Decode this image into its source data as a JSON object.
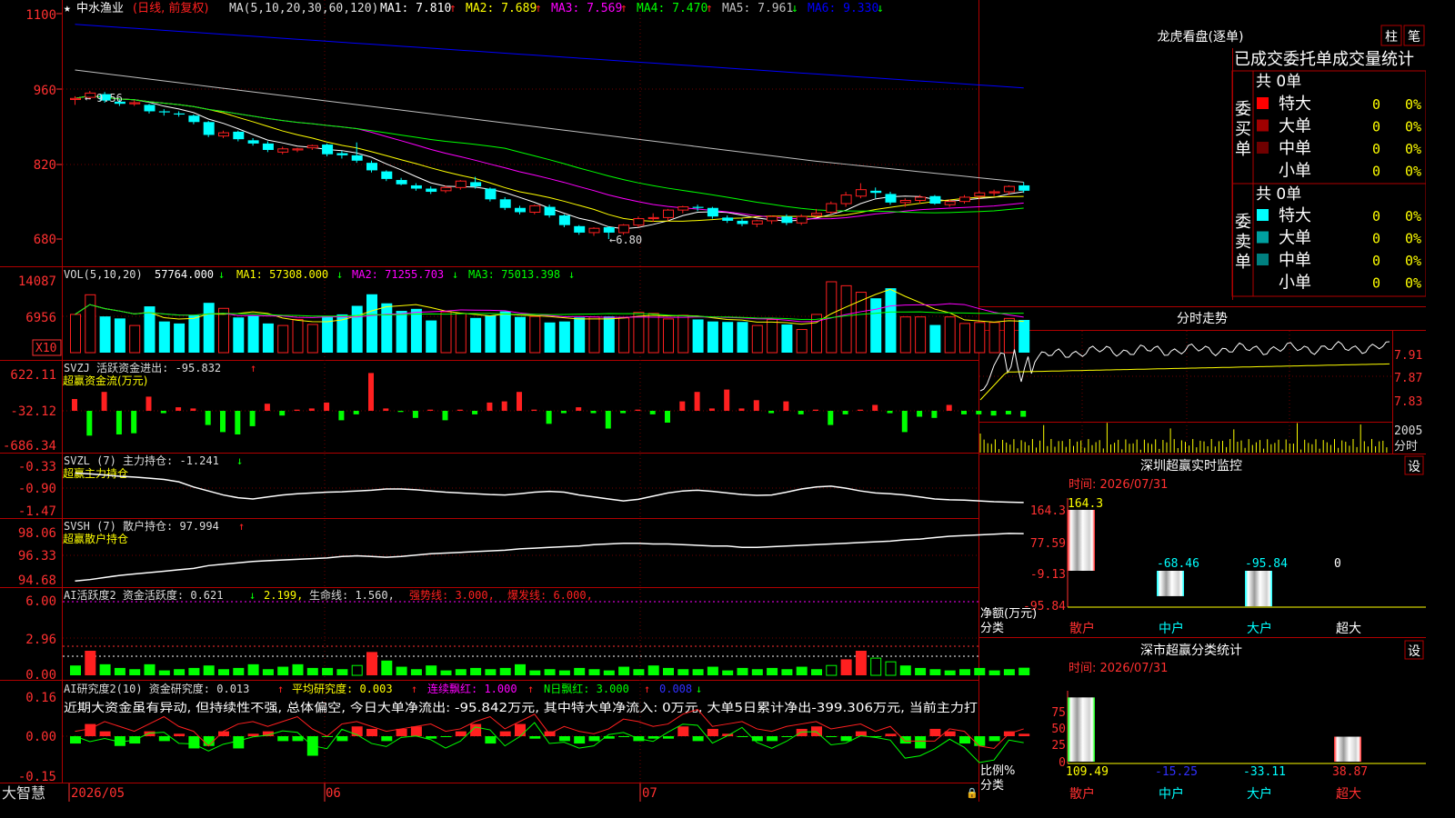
{
  "colors": {
    "up": "#ff2020",
    "down": "#00ffff",
    "grid": "#b00000",
    "ma1": "#ffffff",
    "ma2": "#ffff00",
    "ma3": "#ff00ff",
    "ma4": "#00ff00",
    "ma5": "#c0c0c0",
    "ma6": "#0000ff",
    "bg": "#000000"
  },
  "header": {
    "star": "★",
    "stock": "中水渔业",
    "mode": "(日线, 前复权)",
    "ma_label": "MA(5,10,20,30,60,120)",
    "ma_items": [
      {
        "label": "MA1:",
        "value": "7.810",
        "arrow": "↑"
      },
      {
        "label": "MA2:",
        "value": "7.689",
        "arrow": "↑"
      },
      {
        "label": "MA3:",
        "value": "7.569",
        "arrow": "↑"
      },
      {
        "label": "MA4:",
        "value": "7.470",
        "arrow": "↑"
      },
      {
        "label": "MA5:",
        "value": "7.961",
        "arrow": "↓"
      },
      {
        "label": "MA6:",
        "value": "9.330",
        "arrow": "↓"
      }
    ]
  },
  "price_axis": [
    "1100",
    "960",
    "820",
    "680"
  ],
  "annotations": {
    "high": "9.56",
    "low": "←6.80"
  },
  "vol": {
    "label": "VOL(5,10,20)",
    "value": "57764.000",
    "arrow": "↓",
    "ma1": "MA1: 57308.000",
    "ma1_arrow": "↓",
    "ma2": "MA2: 71255.703",
    "ma2_arrow": "↓",
    "ma3": "MA3: 75013.398",
    "ma3_arrow": "↓",
    "axis": [
      "14087",
      "6956"
    ],
    "unit": "X10"
  },
  "svzj": {
    "label": "SVZJ  活跃资金进出: -95.832",
    "arrow": "↑",
    "sub": "超赢资金流(万元)",
    "axis": [
      "622.11",
      "-32.12",
      "-686.34"
    ]
  },
  "svzl": {
    "label": "SVZL (7) 主力持仓: -1.241",
    "arrow": "↓",
    "sub": "超赢主力持仓",
    "axis": [
      "-0.33",
      "-0.90",
      "-1.47"
    ]
  },
  "svsh": {
    "label": "SVSH (7) 散户持仓: 97.994",
    "arrow": "↑",
    "sub": "超赢散户持仓",
    "axis": [
      "98.06",
      "96.33",
      "94.68"
    ]
  },
  "ai1": {
    "label": "AI活跃度2 资金活跃度: 0.621",
    "arrow": "↓",
    "v2": "2.199,",
    "v3": "生命线: 1.560,",
    "v4": "强势线: 3.000,",
    "v5": "爆发线: 6.000,",
    "axis": [
      "6.00",
      "2.96",
      "0.00"
    ]
  },
  "ai2": {
    "label": "AI研究度2(10) 资金研究度: 0.013",
    "arrow": "↑",
    "v2": "平均研究度: 0.003",
    "v2_arrow": "↑",
    "v3": "连续飘红: 1.000",
    "v3_arrow": "↑",
    "v4": "N日飘红: 3.000",
    "v4_arrow": "↑",
    "v5": "0.008",
    "v5_arrow": "↓",
    "text": "近期大资金虽有异动, 但持续性不强, 总体偏空, 今日大单净流出: -95.842万元, 其中特大单净流入: 0万元, 大单5日累计净出-399.306万元, 当前主力打",
    "axis": [
      "0.16",
      "0.00",
      "-0.15"
    ]
  },
  "bottom_axis": {
    "brand": "大智慧",
    "dates": [
      "2026/05",
      "06",
      "07"
    ]
  },
  "right_panel": {
    "dragon": {
      "title": "龙虎看盘(逐单)",
      "btn1": "柱",
      "btn2": "笔",
      "subtitle": "已成交委托单成交量统计",
      "buy_title": "委买单",
      "sell_title": "委卖单",
      "buy_total": "共 0单",
      "sell_total": "共 0单",
      "buy_rows": [
        {
          "name": "特大",
          "v": "0",
          "p": "0%",
          "c": "#ff0000"
        },
        {
          "name": "大单",
          "v": "0",
          "p": "0%",
          "c": "#a00000"
        },
        {
          "name": "中单",
          "v": "0",
          "p": "0%",
          "c": "#700000"
        },
        {
          "name": "小单",
          "v": "0",
          "p": "0%",
          "c": ""
        }
      ],
      "sell_rows": [
        {
          "name": "特大",
          "v": "0",
          "p": "0%",
          "c": "#00ffff"
        },
        {
          "name": "大单",
          "v": "0",
          "p": "0%",
          "c": "#00a0a0"
        },
        {
          "name": "中单",
          "v": "0",
          "p": "0%",
          "c": "#008080"
        },
        {
          "name": "小单",
          "v": "0",
          "p": "0%",
          "c": ""
        }
      ]
    },
    "intraday": {
      "title": "分时走势",
      "axis": [
        "7.91",
        "7.87",
        "7.83"
      ],
      "vol_label": "2005",
      "unit": "分时"
    },
    "monitor": {
      "title": "深圳超赢实时监控",
      "btn": "设",
      "time": "时间: 2026/07/31",
      "axis": [
        "164.3",
        "77.59",
        "-9.13",
        "-95.84"
      ],
      "ylabel": "净额(万元)",
      "xlabel": "分类",
      "cats": [
        "散户",
        "中户",
        "大户",
        "超大"
      ],
      "values": [
        164.3,
        -68.46,
        -95.84,
        0
      ],
      "value_labels": [
        "164.3",
        "-68.46",
        "-95.84",
        "0"
      ]
    },
    "classify": {
      "title": "深市超赢分类统计",
      "btn": "设",
      "time": "时间: 2026/07/31",
      "axis": [
        "75",
        "50",
        "25",
        "0"
      ],
      "ylabel": "比例%",
      "xlabel": "分类",
      "cats": [
        "散户",
        "中户",
        "大户",
        "超大"
      ],
      "values": [
        109.49,
        -15.25,
        -33.11,
        38.87
      ],
      "value_labels": [
        "109.49",
        "-15.25",
        "-33.11",
        "38.87"
      ]
    }
  },
  "chart_data": {
    "type": "candlestick",
    "title": "中水渔业 (日线, 前复权)",
    "x_start": "2026/05",
    "candles": [
      [
        9.4,
        9.42,
        9.3,
        9.46
      ],
      [
        9.44,
        9.52,
        9.4,
        9.56
      ],
      [
        9.5,
        9.38,
        9.34,
        9.54
      ],
      [
        9.36,
        9.32,
        9.28,
        9.4
      ],
      [
        9.32,
        9.34,
        9.28,
        9.38
      ],
      [
        9.3,
        9.18,
        9.14,
        9.32
      ],
      [
        9.18,
        9.16,
        9.1,
        9.22
      ],
      [
        9.14,
        9.12,
        9.08,
        9.18
      ],
      [
        9.1,
        8.98,
        8.94,
        9.12
      ],
      [
        8.98,
        8.74,
        8.7,
        9.0
      ],
      [
        8.72,
        8.78,
        8.68,
        8.82
      ],
      [
        8.8,
        8.66,
        8.62,
        8.82
      ],
      [
        8.64,
        8.58,
        8.54,
        8.68
      ],
      [
        8.58,
        8.46,
        8.42,
        8.62
      ],
      [
        8.42,
        8.48,
        8.38,
        8.52
      ],
      [
        8.46,
        8.48,
        8.42,
        8.5
      ],
      [
        8.5,
        8.54,
        8.46,
        8.56
      ],
      [
        8.56,
        8.38,
        8.34,
        8.58
      ],
      [
        8.4,
        8.36,
        8.3,
        8.44
      ],
      [
        8.36,
        8.26,
        8.22,
        8.6
      ],
      [
        8.22,
        8.08,
        8.04,
        8.26
      ],
      [
        8.06,
        7.92,
        7.88,
        8.08
      ],
      [
        7.9,
        7.82,
        7.8,
        7.94
      ],
      [
        7.8,
        7.74,
        7.7,
        7.84
      ],
      [
        7.74,
        7.68,
        7.64,
        7.78
      ],
      [
        7.7,
        7.76,
        7.66,
        7.8
      ],
      [
        7.76,
        7.88,
        7.72,
        7.9
      ],
      [
        7.86,
        7.78,
        7.74,
        7.96
      ],
      [
        7.74,
        7.54,
        7.5,
        7.76
      ],
      [
        7.54,
        7.38,
        7.34,
        7.58
      ],
      [
        7.38,
        7.3,
        7.26,
        7.42
      ],
      [
        7.3,
        7.42,
        7.26,
        7.44
      ],
      [
        7.4,
        7.24,
        7.2,
        7.44
      ],
      [
        7.24,
        7.06,
        7.02,
        7.26
      ],
      [
        7.04,
        6.92,
        6.88,
        7.06
      ],
      [
        6.92,
        7.0,
        6.86,
        7.02
      ],
      [
        7.02,
        6.92,
        6.8,
        7.04
      ],
      [
        6.92,
        7.06,
        6.88,
        7.08
      ],
      [
        7.06,
        7.18,
        7.02,
        7.22
      ],
      [
        7.18,
        7.2,
        7.12,
        7.28
      ],
      [
        7.2,
        7.34,
        7.14,
        7.36
      ],
      [
        7.34,
        7.4,
        7.28,
        7.42
      ],
      [
        7.4,
        7.38,
        7.32,
        7.44
      ],
      [
        7.38,
        7.22,
        7.18,
        7.4
      ],
      [
        7.2,
        7.14,
        7.1,
        7.24
      ],
      [
        7.14,
        7.08,
        7.04,
        7.18
      ],
      [
        7.08,
        7.14,
        7.02,
        7.16
      ],
      [
        7.14,
        7.22,
        7.08,
        7.24
      ],
      [
        7.22,
        7.1,
        7.06,
        7.26
      ],
      [
        7.1,
        7.22,
        7.06,
        7.26
      ],
      [
        7.24,
        7.28,
        7.2,
        7.36
      ],
      [
        7.3,
        7.46,
        7.26,
        7.5
      ],
      [
        7.46,
        7.62,
        7.4,
        7.68
      ],
      [
        7.6,
        7.72,
        7.56,
        7.84
      ],
      [
        7.7,
        7.66,
        7.56,
        7.76
      ],
      [
        7.64,
        7.48,
        7.44,
        7.68
      ],
      [
        7.48,
        7.52,
        7.4,
        7.56
      ],
      [
        7.52,
        7.58,
        7.46,
        7.62
      ],
      [
        7.6,
        7.46,
        7.44,
        7.62
      ],
      [
        7.44,
        7.5,
        7.4,
        7.54
      ],
      [
        7.5,
        7.58,
        7.46,
        7.62
      ],
      [
        7.6,
        7.66,
        7.54,
        7.7
      ],
      [
        7.66,
        7.68,
        7.6,
        7.72
      ],
      [
        7.68,
        7.78,
        7.62,
        7.8
      ],
      [
        7.8,
        7.7,
        7.66,
        7.86
      ]
    ],
    "volume": [
      7600,
      11500,
      7200,
      6800,
      5400,
      9200,
      6200,
      5800,
      7400,
      9900,
      8800,
      7000,
      7400,
      5800,
      5400,
      6600,
      5600,
      7300,
      7600,
      9300,
      11600,
      9800,
      8300,
      8700,
      6400,
      8100,
      7800,
      6900,
      7400,
      8200,
      7100,
      7200,
      6000,
      6200,
      7000,
      7100,
      7200,
      6900,
      8000,
      7800,
      6700,
      7400,
      6600,
      6200,
      6100,
      6100,
      5400,
      6600,
      5600,
      4600,
      7600,
      14087,
      13300,
      12000,
      10800,
      12800,
      7100,
      7100,
      5500,
      7100,
      5800,
      6000,
      6000,
      6800,
      6500
    ]
  }
}
